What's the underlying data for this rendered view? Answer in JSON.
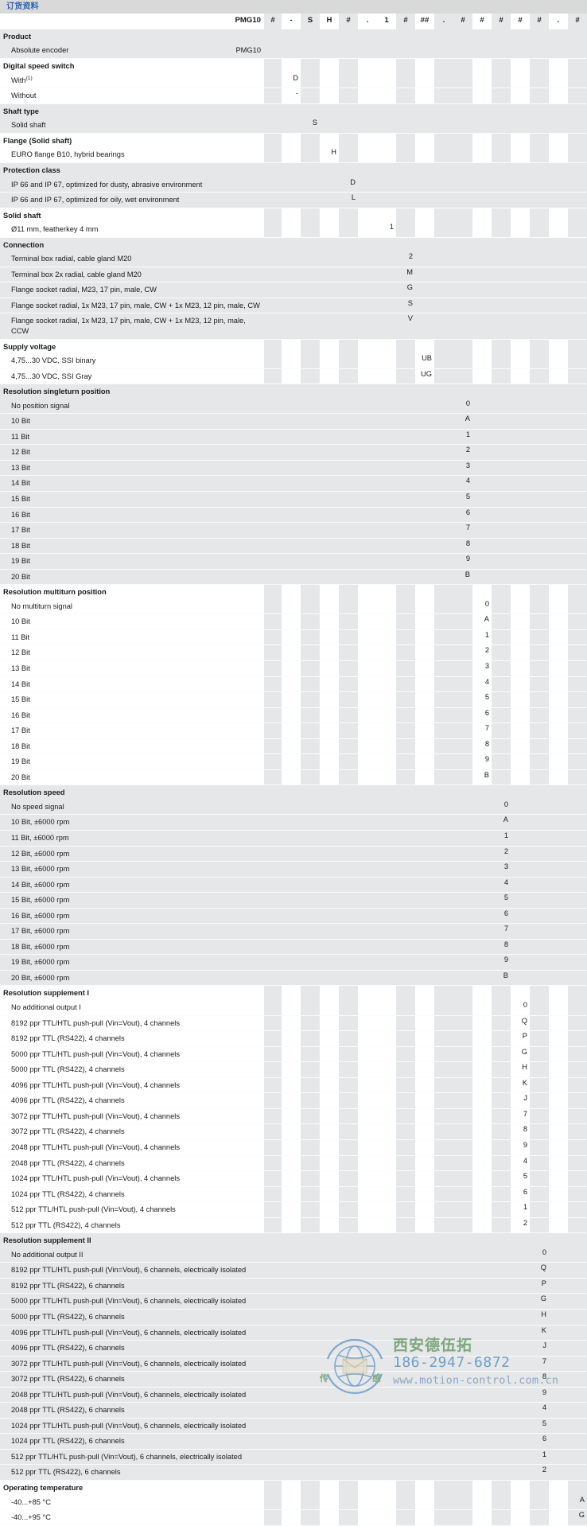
{
  "titlebar": {
    "title": "订货资料"
  },
  "code_header": {
    "base": "PMG10",
    "segments": [
      "#",
      "-",
      "S",
      "H",
      "#",
      ".",
      "1",
      "#",
      "##",
      ".",
      "#",
      "#",
      "#",
      "#",
      "#",
      ".",
      "#"
    ]
  },
  "product_code": "PMG10",
  "sections": [
    {
      "title": "Product",
      "shade": true,
      "col": 0,
      "rows": [
        {
          "label": "Absolute encoder",
          "code": "PMG10"
        }
      ]
    },
    {
      "title": "Digital speed switch",
      "shade": false,
      "col": 1,
      "rows": [
        {
          "label": "With",
          "sup": "(1)",
          "code": "D"
        },
        {
          "label": "Without",
          "code": "-"
        }
      ]
    },
    {
      "title": "Shaft type",
      "shade": true,
      "col": 2,
      "rows": [
        {
          "label": "Solid shaft",
          "code": "S"
        }
      ]
    },
    {
      "title": "Flange (Solid shaft)",
      "shade": false,
      "col": 3,
      "rows": [
        {
          "label": "EURO flange B10, hybrid bearings",
          "code": "H"
        }
      ]
    },
    {
      "title": "Protection class",
      "shade": true,
      "col": 4,
      "rows": [
        {
          "label": "IP 66 and IP 67, optimized for dusty, abrasive environment",
          "code": "D"
        },
        {
          "label": "IP 66 and IP 67, optimized for oily, wet environment",
          "code": "L"
        }
      ]
    },
    {
      "title": "Solid shaft",
      "shade": false,
      "col": 6,
      "rows": [
        {
          "label": "Ø11 mm, featherkey 4 mm",
          "code": "1"
        }
      ]
    },
    {
      "title": "Connection",
      "shade": true,
      "col": 7,
      "rows": [
        {
          "label": "Terminal box radial, cable gland M20",
          "code": "2"
        },
        {
          "label": "Terminal box 2x radial, cable gland M20",
          "code": "M"
        },
        {
          "label": "Flange socket radial, M23, 17 pin, male, CW",
          "code": "G"
        },
        {
          "label": "Flange socket radial, 1x M23, 17 pin, male, CW + 1x M23, 12 pin, male, CW",
          "code": "S"
        },
        {
          "label": "Flange socket radial, 1x M23, 17 pin, male, CW + 1x M23, 12 pin, male, CCW",
          "code": "V"
        }
      ]
    },
    {
      "title": "Supply voltage",
      "shade": false,
      "col": 8,
      "rows": [
        {
          "label": "4,75...30 VDC, SSI binary",
          "code": "UB"
        },
        {
          "label": "4,75...30 VDC, SSI Gray",
          "code": "UG"
        }
      ]
    },
    {
      "title": "Resolution singleturn position",
      "shade": true,
      "col": 10,
      "rows": [
        {
          "label": "No position signal",
          "code": "0"
        },
        {
          "label": "10 Bit",
          "code": "A"
        },
        {
          "label": "11 Bit",
          "code": "1"
        },
        {
          "label": "12 Bit",
          "code": "2"
        },
        {
          "label": "13 Bit",
          "code": "3"
        },
        {
          "label": "14 Bit",
          "code": "4"
        },
        {
          "label": "15 Bit",
          "code": "5"
        },
        {
          "label": "16 Bit",
          "code": "6"
        },
        {
          "label": "17 Bit",
          "code": "7"
        },
        {
          "label": "18 Bit",
          "code": "8"
        },
        {
          "label": "19 Bit",
          "code": "9"
        },
        {
          "label": "20 Bit",
          "code": "B"
        }
      ]
    },
    {
      "title": "Resolution multiturn position",
      "shade": false,
      "col": 11,
      "rows": [
        {
          "label": "No multiturn signal",
          "code": "0"
        },
        {
          "label": "10 Bit",
          "code": "A"
        },
        {
          "label": "11 Bit",
          "code": "1"
        },
        {
          "label": "12 Bit",
          "code": "2"
        },
        {
          "label": "13 Bit",
          "code": "3"
        },
        {
          "label": "14 Bit",
          "code": "4"
        },
        {
          "label": "15 Bit",
          "code": "5"
        },
        {
          "label": "16 Bit",
          "code": "6"
        },
        {
          "label": "17 Bit",
          "code": "7"
        },
        {
          "label": "18 Bit",
          "code": "8"
        },
        {
          "label": "19 Bit",
          "code": "9"
        },
        {
          "label": "20 Bit",
          "code": "B"
        }
      ]
    },
    {
      "title": "Resolution speed",
      "shade": true,
      "col": 12,
      "rows": [
        {
          "label": "No speed signal",
          "code": "0"
        },
        {
          "label": "10 Bit, ±6000 rpm",
          "code": "A"
        },
        {
          "label": "11 Bit, ±6000 rpm",
          "code": "1"
        },
        {
          "label": "12 Bit, ±6000 rpm",
          "code": "2"
        },
        {
          "label": "13 Bit, ±6000 rpm",
          "code": "3"
        },
        {
          "label": "14 Bit, ±6000 rpm",
          "code": "4"
        },
        {
          "label": "15 Bit, ±6000 rpm",
          "code": "5"
        },
        {
          "label": "16 Bit, ±6000 rpm",
          "code": "6"
        },
        {
          "label": "17 Bit, ±6000 rpm",
          "code": "7"
        },
        {
          "label": "18 Bit, ±6000 rpm",
          "code": "8"
        },
        {
          "label": "19 Bit, ±6000 rpm",
          "code": "9"
        },
        {
          "label": "20 Bit, ±6000 rpm",
          "code": "B"
        }
      ]
    },
    {
      "title": "Resolution supplement I",
      "shade": false,
      "col": 13,
      "rows": [
        {
          "label": "No additional output I",
          "code": "0"
        },
        {
          "label": "8192 ppr TTL/HTL push-pull (Vin=Vout), 4 channels",
          "code": "Q"
        },
        {
          "label": "8192 ppr TTL (RS422), 4 channels",
          "code": "P"
        },
        {
          "label": "5000 ppr TTL/HTL push-pull (Vin=Vout), 4 channels",
          "code": "G"
        },
        {
          "label": "5000 ppr TTL (RS422), 4 channels",
          "code": "H"
        },
        {
          "label": "4096 ppr TTL/HTL push-pull (Vin=Vout), 4 channels",
          "code": "K"
        },
        {
          "label": "4096 ppr TTL (RS422), 4 channels",
          "code": "J"
        },
        {
          "label": "3072 ppr TTL/HTL push-pull (Vin=Vout), 4 channels",
          "code": "7"
        },
        {
          "label": "3072 ppr TTL (RS422), 4 channels",
          "code": "8"
        },
        {
          "label": "2048 ppr TTL/HTL push-pull (Vin=Vout), 4 channels",
          "code": "9"
        },
        {
          "label": "2048 ppr TTL (RS422), 4 channels",
          "code": "4"
        },
        {
          "label": "1024 ppr TTL/HTL push-pull (Vin=Vout), 4 channels",
          "code": "5"
        },
        {
          "label": "1024 ppr TTL (RS422), 4 channels",
          "code": "6"
        },
        {
          "label": "512 ppr TTL/HTL push-pull (Vin=Vout), 4 channels",
          "code": "1"
        },
        {
          "label": "512 ppr TTL (RS422), 4 channels",
          "code": "2"
        }
      ]
    },
    {
      "title": "Resolution supplement II",
      "shade": true,
      "col": 14,
      "rows": [
        {
          "label": "No additional output II",
          "code": "0"
        },
        {
          "label": "8192 ppr TTL/HTL push-pull (Vin=Vout), 6 channels, electrically isolated",
          "code": "Q"
        },
        {
          "label": "8192 ppr TTL (RS422), 6 channels",
          "code": "P"
        },
        {
          "label": "5000 ppr TTL/HTL push-pull (Vin=Vout), 6 channels, electrically isolated",
          "code": "G"
        },
        {
          "label": "5000 ppr TTL (RS422), 6 channels",
          "code": "H"
        },
        {
          "label": "4096 ppr TTL/HTL push-pull (Vin=Vout), 6 channels, electrically isolated",
          "code": "K"
        },
        {
          "label": "4096 ppr TTL (RS422), 6 channels",
          "code": "J"
        },
        {
          "label": "3072 ppr TTL/HTL push-pull (Vin=Vout), 6 channels, electrically isolated",
          "code": "7"
        },
        {
          "label": "3072 ppr TTL (RS422), 6 channels",
          "code": "8"
        },
        {
          "label": "2048 ppr TTL/HTL push-pull (Vin=Vout), 6 channels, electrically isolated",
          "code": "9"
        },
        {
          "label": "2048 ppr TTL (RS422), 6 channels",
          "code": "4"
        },
        {
          "label": "1024 ppr TTL/HTL push-pull (Vin=Vout), 6 channels, electrically isolated",
          "code": "5"
        },
        {
          "label": "1024 ppr TTL (RS422), 6 channels",
          "code": "6"
        },
        {
          "label": "512 ppr TTL/HTL push-pull (Vin=Vout), 6 channels, electrically isolated",
          "code": "1"
        },
        {
          "label": "512 ppr TTL (RS422), 6 channels",
          "code": "2"
        }
      ]
    },
    {
      "title": "Operating temperature",
      "shade": false,
      "col": 16,
      "rows": [
        {
          "label": "-40...+85 °C",
          "code": "A"
        },
        {
          "label": "-40...+95 °C",
          "code": "G"
        }
      ]
    }
  ],
  "watermark": {
    "company": "西安德伍拓",
    "phone": "186-2947-6872",
    "website": "www.motion-control.com.cn"
  },
  "colors": {
    "title_text": "#2a62ad",
    "titlebar_bg": "#d9d9d9",
    "row_shade": "#e6e7e9",
    "row_plain": "#ffffff",
    "watermark_green": "#7fa77e",
    "watermark_blue": "#6e9ec9"
  }
}
